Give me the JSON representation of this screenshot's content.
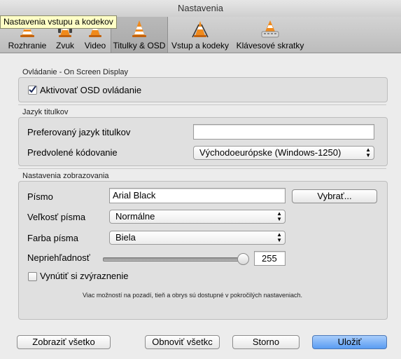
{
  "window": {
    "title": "Nastavenia"
  },
  "tooltip": "Nastavenia vstupu a kodekov",
  "tabs": [
    {
      "label": "Rozhranie",
      "icon": "cone-icon",
      "selected": false
    },
    {
      "label": "Zvuk",
      "icon": "cone-headphones-icon",
      "selected": false
    },
    {
      "label": "Video",
      "icon": "cone-video-icon",
      "selected": false
    },
    {
      "label": "Titulky & OSD",
      "icon": "cone-subtitles-icon",
      "selected": true
    },
    {
      "label": "Vstup a kodeky",
      "icon": "cone-codecs-icon",
      "selected": false
    },
    {
      "label": "Klávesové skratky",
      "icon": "cone-hotkeys-icon",
      "selected": false
    }
  ],
  "osd": {
    "section_label": "Ovládanie - On Screen Display",
    "enable_label": "Aktivovať OSD ovládanie",
    "enable_checked": true
  },
  "subtitle_lang": {
    "section_label": "Jazyk titulkov",
    "preferred_label": "Preferovaný jazyk titulkov",
    "preferred_value": "",
    "encoding_label": "Predvolené kódovanie",
    "encoding_value": "Východoeurópske (Windows-1250)"
  },
  "display": {
    "section_label": "Nastavenia zobrazovania",
    "font_label": "Písmo",
    "font_value": "Arial Black",
    "choose_button": "Vybrať...",
    "size_label": "Veľkosť písma",
    "size_value": "Normálne",
    "color_label": "Farba písma",
    "color_value": "Biela",
    "opacity_label": "Nepriehľadnosť",
    "opacity_value": "255",
    "opacity_fraction": 1.0,
    "outline_label": "Vynútiť si zvýraznenie",
    "outline_checked": false,
    "note": "Viac možností na pozadí, tieň a obrys sú dostupné v pokročilých nastaveniach."
  },
  "buttons": {
    "show_all": "Zobraziť všetko",
    "reset_all": "Obnoviť všetkc",
    "cancel": "Storno",
    "save": "Uložiť"
  }
}
